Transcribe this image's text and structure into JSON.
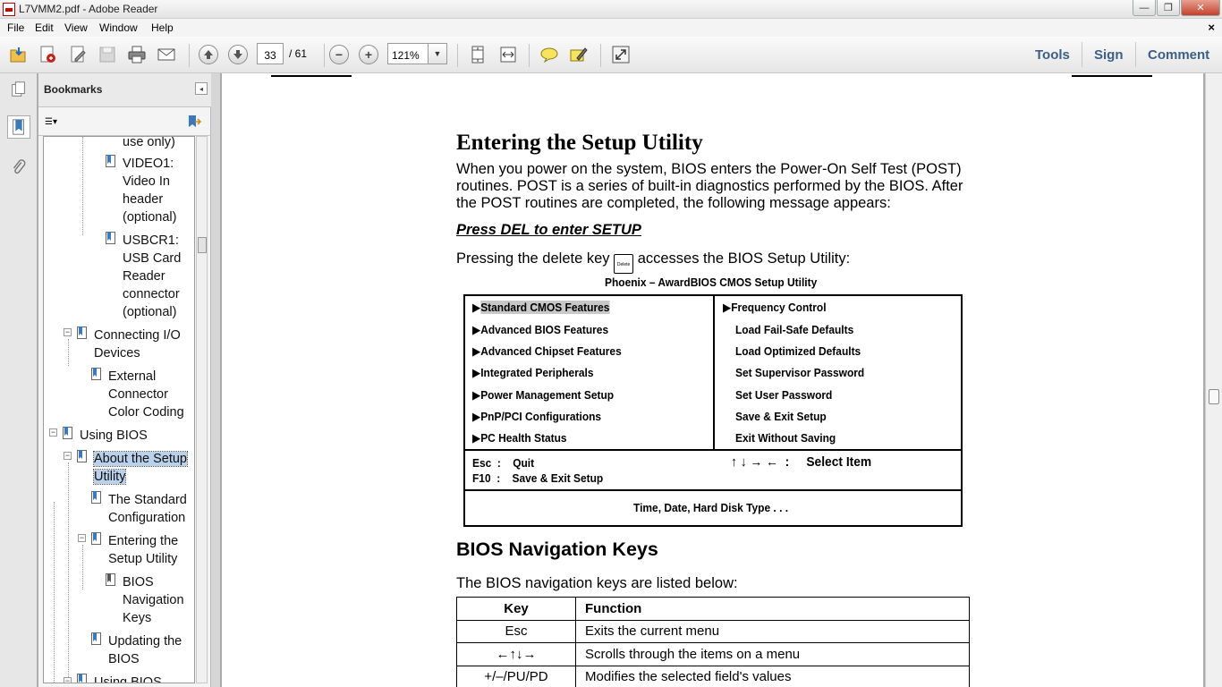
{
  "window": {
    "title": "L7VMM2.pdf - Adobe Reader",
    "min": "—",
    "max": "❐",
    "close": "✕"
  },
  "menu": {
    "items": [
      "File",
      "Edit",
      "View",
      "Window",
      "Help"
    ],
    "doc_close": "×"
  },
  "toolbar": {
    "page_current": "33",
    "page_total": "/ 61",
    "zoom": "121%",
    "zoom_drop": "▼",
    "zoom_out": "−",
    "zoom_in": "+",
    "right_links": [
      "Tools",
      "Sign",
      "Comment"
    ]
  },
  "bookmarks": {
    "title": "Bookmarks",
    "collapse": "◂",
    "options": "☰▾",
    "items": [
      {
        "label": [
          "use only)"
        ]
      },
      {
        "label": [
          "VIDEO1:",
          "Video In",
          "header",
          "(optional)"
        ]
      },
      {
        "label": [
          "USBCR1:",
          "USB Card",
          "Reader",
          "connector",
          "(optional)"
        ]
      },
      {
        "label": [
          "Connecting I/O",
          "Devices"
        ]
      },
      {
        "label": [
          "External",
          "Connector",
          "Color Coding"
        ]
      },
      {
        "label": [
          "Using BIOS"
        ]
      },
      {
        "label": [
          "About the Setup",
          "Utility"
        ]
      },
      {
        "label": [
          "The Standard",
          "Configuration"
        ]
      },
      {
        "label": [
          "Entering the",
          "Setup Utility"
        ]
      },
      {
        "label": [
          "BIOS",
          "Navigation",
          "Keys"
        ]
      },
      {
        "label": [
          "Updating the",
          "BIOS"
        ]
      },
      {
        "label": [
          "Using BIOS"
        ]
      }
    ]
  },
  "doc": {
    "heading": "Entering the Setup Utility",
    "intro": "When you power on the system, BIOS enters the Power-On Self Test (POST) routines. POST is a series of built-in diagnostics performed by the BIOS. After the POST routines are completed, the following message appears:",
    "press": "Press DEL to enter SETUP",
    "pressing_a": "Pressing the delete key ",
    "keycap": "Delete",
    "pressing_b": " accesses the BIOS Setup Utility:",
    "bios_title": "Phoenix – AwardBIOS CMOS Setup Utility",
    "bios_left": [
      "Standard CMOS Features",
      "Advanced BIOS Features",
      "Advanced Chipset Features",
      "Integrated Peripherals",
      "Power Management Setup",
      "PnP/PCI Configurations",
      "PC Health Status"
    ],
    "bios_right": [
      "Frequency Control",
      "Load Fail-Safe Defaults",
      "Load Optimized Defaults",
      "Set Supervisor Password",
      "Set User Password",
      "Save & Exit Setup",
      "Exit Without Saving"
    ],
    "bios_arrow": "▶",
    "bios_esc": "Esc  :    Quit",
    "bios_f10": "F10  :    Save & Exit Setup",
    "bios_arrows": "↑ ↓ → ←  :     Select Item",
    "bios_footer": "Time, Date, Hard Disk Type . . .",
    "nav_heading": "BIOS Navigation Keys",
    "nav_intro": "The BIOS navigation keys are listed below:",
    "nav_table": {
      "headers": [
        "Key",
        "Function"
      ],
      "rows": [
        [
          "Esc",
          "Exits the current menu"
        ],
        [
          "←↑↓→",
          "Scrolls through the items on a menu"
        ],
        [
          "+/–/PU/PD",
          "Modifies the selected field's values"
        ]
      ]
    }
  }
}
